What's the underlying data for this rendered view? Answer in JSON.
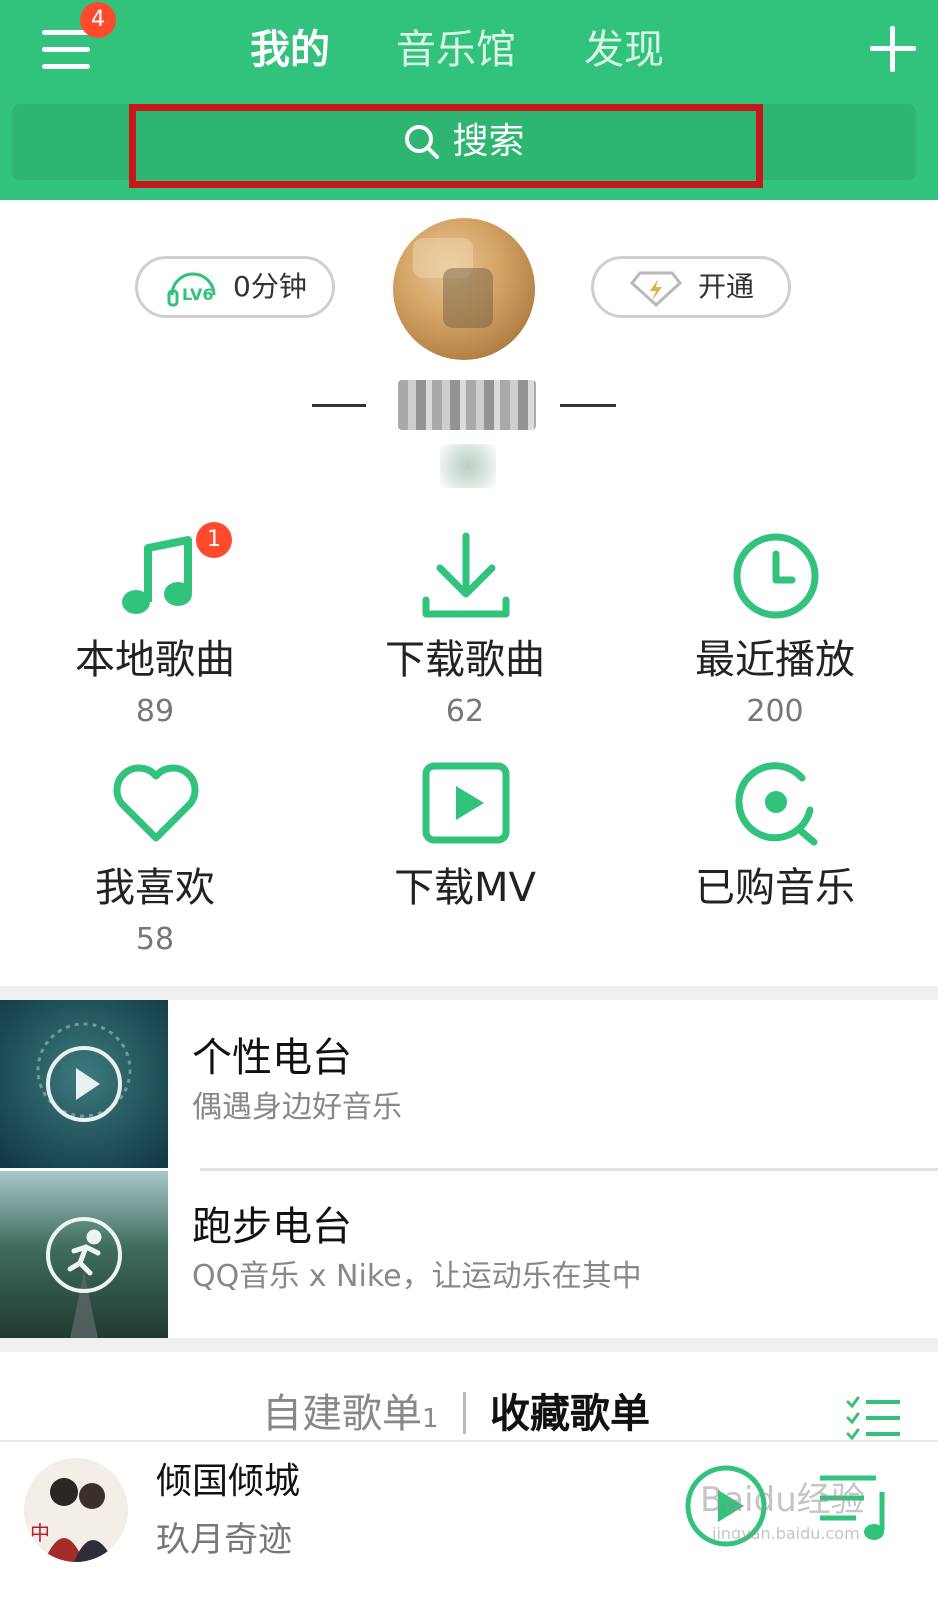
{
  "header": {
    "menu_badge": "4",
    "tabs": [
      {
        "label": "我的",
        "active": true
      },
      {
        "label": "音乐馆",
        "active": false
      },
      {
        "label": "发现",
        "active": false
      }
    ],
    "search_label": "搜索"
  },
  "profile": {
    "listen_level": "LV6",
    "listen_time": "0分钟",
    "vip_label": "开通"
  },
  "quick_access": [
    {
      "label": "本地歌曲",
      "count": "89",
      "badge": "1",
      "icon": "music-note-icon"
    },
    {
      "label": "下载歌曲",
      "count": "62",
      "icon": "download-icon"
    },
    {
      "label": "最近播放",
      "count": "200",
      "icon": "clock-icon"
    },
    {
      "label": "我喜欢",
      "count": "58",
      "icon": "heart-icon"
    },
    {
      "label": "下载MV",
      "icon": "video-play-icon"
    },
    {
      "label": "已购音乐",
      "icon": "purchased-disc-icon"
    }
  ],
  "radios": [
    {
      "title": "个性电台",
      "subtitle": "偶遇身边好音乐"
    },
    {
      "title": "跑步电台",
      "subtitle": "QQ音乐 x Nike，让运动乐在其中"
    }
  ],
  "playlists": {
    "created_label": "自建歌单",
    "created_count": "1",
    "collected_label": "收藏歌单"
  },
  "player": {
    "title": "倾国倾城",
    "artist": "玖月奇迹",
    "watermark": "Baidu经验",
    "watermark_sub": "jingyan.baidu.com"
  },
  "colors": {
    "brand_green": "#31c27c",
    "highlight_red": "#c8161d",
    "badge_red": "#ff4a2e"
  }
}
